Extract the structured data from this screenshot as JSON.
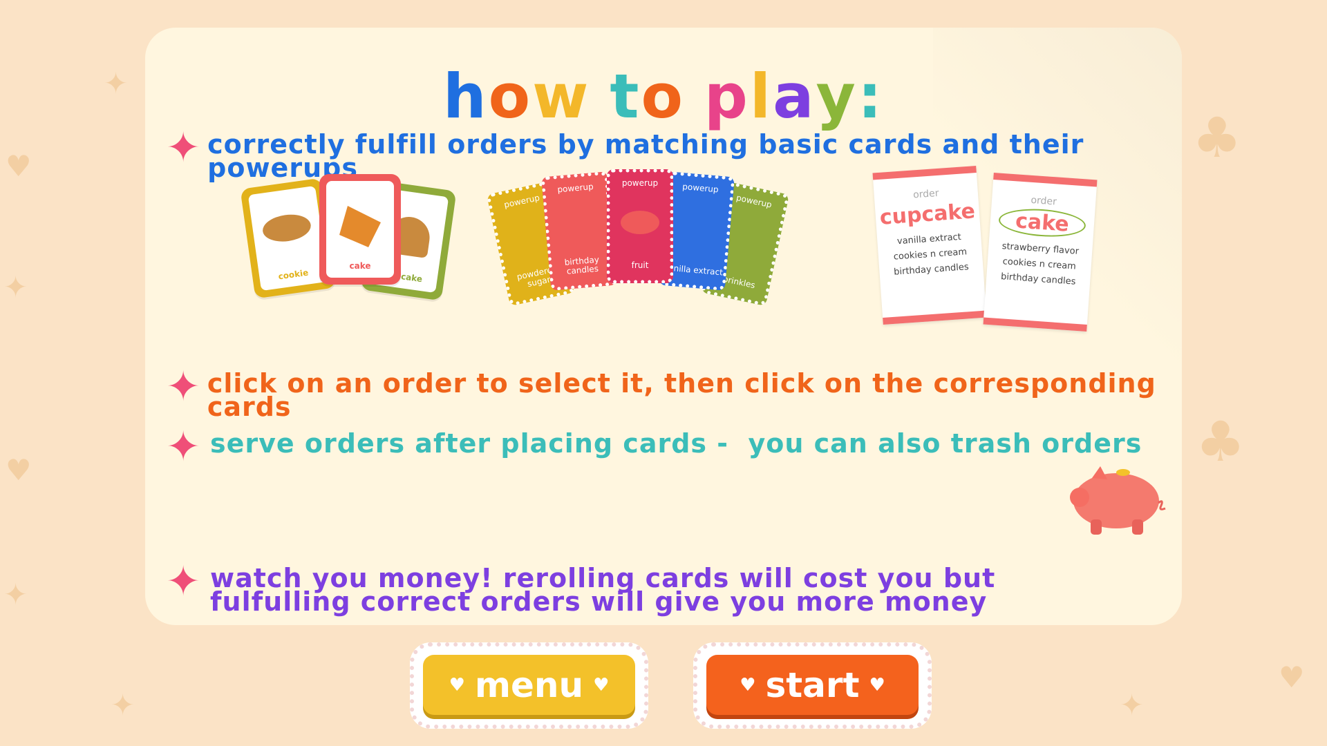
{
  "title_letters": [
    "h",
    "o",
    "w",
    " ",
    "t",
    "o",
    " ",
    "p",
    "l",
    "a",
    "y",
    ":"
  ],
  "title_colors": [
    "#1f6fe0",
    "#f0641a",
    "#f3b72a",
    "#ffffff",
    "#3bbdb9",
    "#f0641a",
    "#ffffff",
    "#e8438a",
    "#f3b72a",
    "#7d3fe0",
    "#8bb63a",
    "#3bbdb9"
  ],
  "rules": [
    "correctly fulfill orders by matching basic cards and their powerups",
    "click on an order to select it, then click on the corresponding cards",
    "serve orders after placing cards -  you can also trash orders",
    "watch you money! rerolling cards will cost you but fulfulling correct orders will give you more money"
  ],
  "basic_cards": [
    {
      "label": "cookie",
      "color": "#e2b21a"
    },
    {
      "label": "cake",
      "color": "#ef5a5a"
    },
    {
      "label": "cupcake",
      "color": "#8faa3a"
    }
  ],
  "powerup_cards": [
    {
      "title": "powerup",
      "label": "powdered sugar",
      "color": "#e0b21a"
    },
    {
      "title": "powerup",
      "label": "birthday candles",
      "color": "#ef5a5a"
    },
    {
      "title": "powerup",
      "label": "fruit",
      "color": "#e0345e"
    },
    {
      "title": "powerup",
      "label": "vanilla extract",
      "color": "#2f6fe0"
    },
    {
      "title": "powerup",
      "label": "sprinkles",
      "color": "#8faa3a"
    }
  ],
  "orders": [
    {
      "header": "order",
      "name": "cupcake",
      "items": [
        "vanilla extract",
        "cookies n cream",
        "birthday candles"
      ]
    },
    {
      "header": "order",
      "name": "cake",
      "items": [
        "strawberry flavor",
        "cookies n cream",
        "birthday candles"
      ]
    }
  ],
  "buttons": {
    "menu": "menu",
    "start": "start"
  },
  "icons": {
    "bullet": "sparkle-star-icon",
    "heart": "heart-icon",
    "piggy": "piggy-bank-icon"
  }
}
